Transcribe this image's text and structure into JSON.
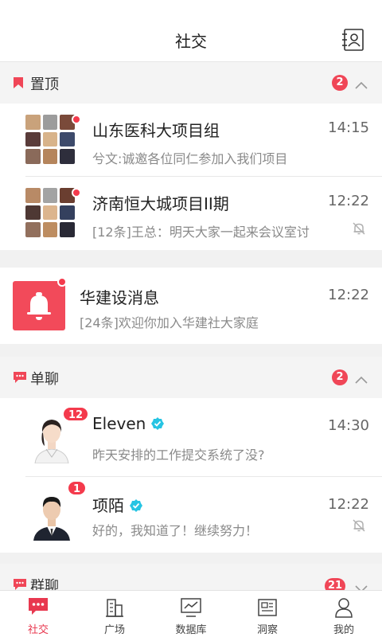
{
  "header": {
    "title": "社交",
    "contacts_icon": "contacts-book-icon"
  },
  "pinned": {
    "label": "置顶",
    "badge": "2",
    "items": [
      {
        "name": "山东医科大项目组",
        "time": "14:15",
        "preview": "兮文:诚邀各位同仁参加入我们项目",
        "muted": false
      },
      {
        "name": "济南恒大城项目II期",
        "time": "12:22",
        "preview": "[12条]王总：明天大家一起来会议室讨",
        "muted": true
      }
    ]
  },
  "notice": {
    "name": "华建设消息",
    "time": "12:22",
    "preview": "[24条]欢迎你加入华建社大家庭"
  },
  "chat": {
    "label": "单聊",
    "badge": "2",
    "items": [
      {
        "name": "Eleven",
        "count": "12",
        "time": "14:30",
        "preview": "昨天安排的工作提交系统了没?",
        "muted": false
      },
      {
        "name": "项陌",
        "count": "1",
        "time": "12:22",
        "preview": "好的，我知道了！继续努力！",
        "muted": true
      }
    ]
  },
  "group": {
    "label": "群聊",
    "badge": "21"
  },
  "tabs": [
    {
      "label": "社交",
      "icon": "chat-bubble-icon",
      "active": true
    },
    {
      "label": "广场",
      "icon": "buildings-icon",
      "active": false
    },
    {
      "label": "数据库",
      "icon": "chart-monitor-icon",
      "active": false
    },
    {
      "label": "洞察",
      "icon": "news-icon",
      "active": false
    },
    {
      "label": "我的",
      "icon": "person-icon",
      "active": false
    }
  ],
  "colors": {
    "accent": "#f04657",
    "muted_text": "#8a8a8a",
    "verify": "#26c4e3"
  }
}
